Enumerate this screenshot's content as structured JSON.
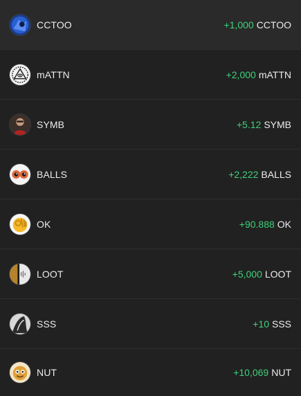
{
  "colors": {
    "background": "#202020",
    "row_hover": "#2a2a2a",
    "divider": "#2f2f2f",
    "positive": "#3fd17c",
    "text": "#ececec"
  },
  "tokens": [
    {
      "symbol": "CCTOO",
      "amount": "+1,000",
      "unit": "CCTOO",
      "icon": "cctoo-avatar-icon"
    },
    {
      "symbol": "mATTN",
      "amount": "+2,000",
      "unit": "mATTN",
      "icon": "mattn-eye-pyramid-icon"
    },
    {
      "symbol": "SYMB",
      "amount": "+5.12",
      "unit": "SYMB",
      "icon": "symb-portrait-icon"
    },
    {
      "symbol": "BALLS",
      "amount": "+2,222",
      "unit": "BALLS",
      "icon": "balls-eyes-icon"
    },
    {
      "symbol": "OK",
      "amount": "+90.888",
      "unit": "OK",
      "icon": "ok-hand-icon"
    },
    {
      "symbol": "LOOT",
      "amount": "+5,000",
      "unit": "LOOT",
      "icon": "loot-avatar-icon"
    },
    {
      "symbol": "SSS",
      "amount": "+10",
      "unit": "SSS",
      "icon": "sss-avatar-icon"
    },
    {
      "symbol": "NUT",
      "amount": "+10,069",
      "unit": "NUT",
      "icon": "nut-avatar-icon"
    }
  ]
}
